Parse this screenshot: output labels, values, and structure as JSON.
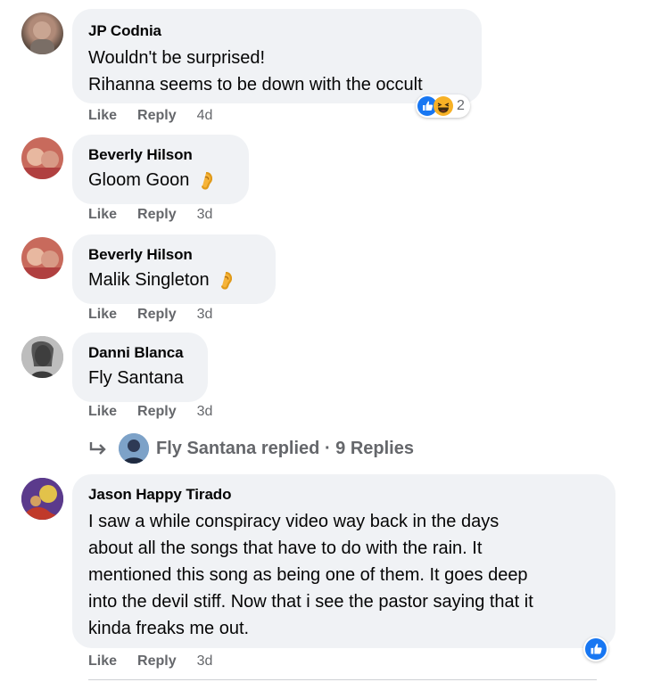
{
  "comments": [
    {
      "author": "JP Codnia",
      "lines": [
        "Wouldn't be surprised!",
        "Rihanna seems to be down with the occult"
      ],
      "like": "Like",
      "reply": "Reply",
      "time": "4d",
      "reaction_count": "2"
    },
    {
      "author": "Beverly Hilson",
      "text": "Gloom Goon",
      "like": "Like",
      "reply": "Reply",
      "time": "3d"
    },
    {
      "author": "Beverly Hilson",
      "text": "Malik Singleton",
      "like": "Like",
      "reply": "Reply",
      "time": "3d"
    },
    {
      "author": "Danni Blanca",
      "text": "Fly Santana",
      "like": "Like",
      "reply": "Reply",
      "time": "3d"
    },
    {
      "author": "Jason Happy Tirado",
      "lines": [
        "I saw a while conspiracy video way back in the days",
        "about all the songs that have to do with the rain. It",
        "mentioned this song as being one of them. It goes deep",
        "into the devil stiff. Now that i see the pastor saying that it",
        "kinda freaks me out."
      ],
      "like": "Like",
      "reply": "Reply",
      "time": "3d"
    }
  ],
  "replies_summary": "Fly Santana replied · 9 Replies",
  "colors": {
    "bubble": "#f0f2f5",
    "meta": "#65676b",
    "like_blue": "#1877f2"
  }
}
